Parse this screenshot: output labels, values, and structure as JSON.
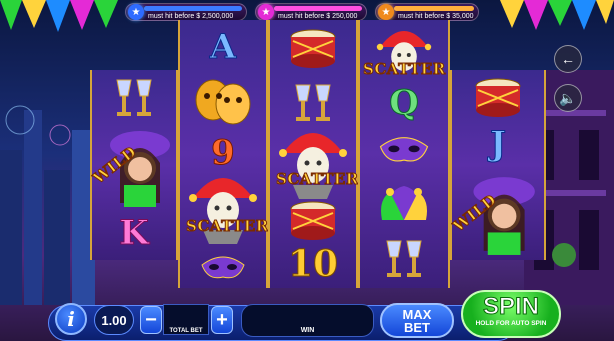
{
  "jackpots": [
    {
      "label": "must hit before $ 2,500,000",
      "color": "#2e6bff"
    },
    {
      "label": "must hit before $ 250,000",
      "color": "#e42ad6"
    },
    {
      "label": "must hit before $ 35,000",
      "color": "#f08a1c"
    }
  ],
  "reels": {
    "reel1": [
      "goblets",
      "wild-lady",
      "K"
    ],
    "reel2": [
      "A",
      "theatre-masks",
      "9",
      "jester-scatter",
      "mask"
    ],
    "reel3": [
      "drum",
      "goblets",
      "jester-scatter",
      "drum",
      "10"
    ],
    "reel4": [
      "jester-scatter",
      "Q",
      "mask",
      "jester-hat",
      "goblets"
    ],
    "reel5": [
      "drum",
      "J",
      "wild-lady"
    ]
  },
  "symbols": {
    "A": "A",
    "K": "K",
    "Q": "Q",
    "J": "J",
    "nine": "9",
    "ten": "10",
    "wild": "WILD",
    "scatter": "SCATTER"
  },
  "controls": {
    "info_label": "i",
    "denomination": "1.00",
    "minus": "−",
    "plus": "+",
    "total_bet_label": "TOTAL BET",
    "win_label": "WIN",
    "max_bet_line1": "MAX",
    "max_bet_line2": "BET",
    "spin_label": "SPIN",
    "spin_sub": "HOLD FOR AUTO SPIN"
  },
  "side": {
    "back_icon": "back-arrow-icon",
    "sound_icon": "speaker-icon"
  }
}
